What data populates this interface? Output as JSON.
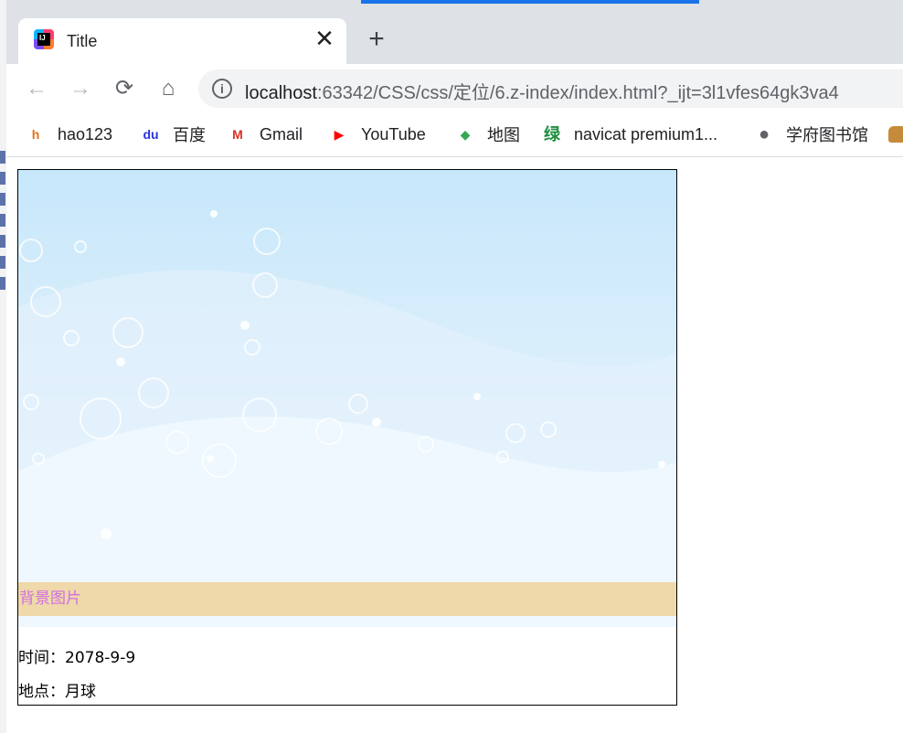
{
  "browser": {
    "tab": {
      "title": "Title",
      "close_glyph": "✕"
    },
    "new_tab_glyph": "+",
    "nav": {
      "back": "←",
      "forward": "→",
      "reload": "⟳",
      "home": "⌂"
    },
    "address": {
      "host": "localhost",
      "rest": ":63342/CSS/css/定位/6.z-index/index.html?_ijt=3l1vfes64gk3va4"
    },
    "bookmarks": [
      {
        "label": "hao123",
        "icon": "hao123-icon",
        "glyph": "h",
        "color": "#e96f13"
      },
      {
        "label": "百度",
        "icon": "baidu-paw-icon",
        "glyph": "du",
        "color": "#2932e1"
      },
      {
        "label": "Gmail",
        "icon": "gmail-icon",
        "glyph": "M",
        "color": "#d93025"
      },
      {
        "label": "YouTube",
        "icon": "youtube-icon",
        "glyph": "▶",
        "color": "#ff0000"
      },
      {
        "label": "地图",
        "icon": "maps-icon",
        "glyph": "◆",
        "color": "#34a853"
      },
      {
        "label": "navicat premium1...",
        "icon": "green-character-icon",
        "glyph": "绿",
        "color": "#1e8e3e"
      },
      {
        "label": "学府图书馆",
        "icon": "globe-icon",
        "glyph": "●",
        "color": "#5f6368"
      },
      {
        "label": "",
        "icon": "folder-icon",
        "glyph": "",
        "color": "#c58a3a"
      }
    ]
  },
  "page": {
    "caption": "背景图片",
    "time": "时间：2078-9-9",
    "place": "地点：月球"
  }
}
